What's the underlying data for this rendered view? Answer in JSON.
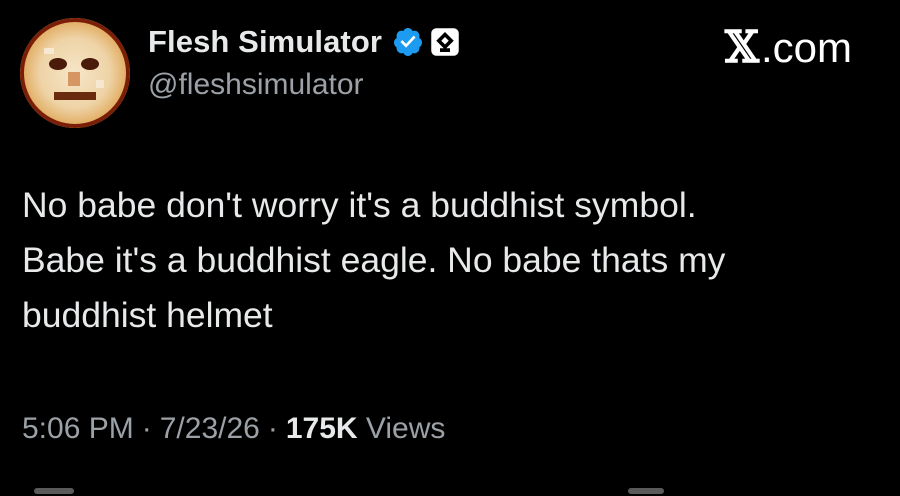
{
  "author": {
    "display_name": "Flesh Simulator",
    "handle": "@fleshsimulator",
    "avatar_icon": "distorted-face-avatar",
    "verified_icon": "verified-badge-icon",
    "affiliate_icon": "affiliate-badge-icon"
  },
  "brand": {
    "x_glyph": "𝕏",
    "domain": ".com"
  },
  "tweet": {
    "lines": [
      "No babe don't worry it's a buddhist symbol.",
      "Babe it's a buddhist eagle. No babe thats my",
      "buddhist helmet"
    ]
  },
  "meta": {
    "time": "5:06 PM",
    "separator": "·",
    "date": "7/23/26",
    "views_count": "175K",
    "views_label": "Views"
  },
  "colors": {
    "background": "#000000",
    "text_primary": "#e7e9ea",
    "text_secondary": "#9ba1a6",
    "verified_blue": "#1d9bf0"
  }
}
